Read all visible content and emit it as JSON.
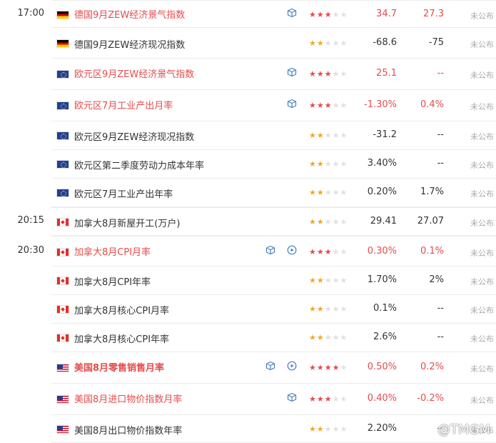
{
  "rows": [
    {
      "time": "17:00",
      "flag": "de",
      "name": "德国9月ZEW经济景气指数",
      "style": "red",
      "icons": [
        "box"
      ],
      "stars": 3,
      "star_color": "red",
      "actual": "34.7",
      "actual_red": true,
      "forecast": "27.3",
      "forecast_red": true,
      "status": "未公布"
    },
    {
      "time": "",
      "flag": "de",
      "name": "德国9月ZEW经济现况指数",
      "style": "normal",
      "icons": [],
      "stars": 2,
      "star_color": "yellow",
      "actual": "-68.6",
      "actual_red": false,
      "forecast": "-75",
      "forecast_red": false,
      "status": "未公布"
    },
    {
      "time": "",
      "flag": "eu",
      "name": "欧元区9月ZEW经济景气指数",
      "style": "red",
      "icons": [
        "box"
      ],
      "stars": 3,
      "star_color": "red",
      "actual": "25.1",
      "actual_red": true,
      "forecast": "--",
      "forecast_red": true,
      "status": "未公布"
    },
    {
      "time": "",
      "flag": "eu",
      "name": "欧元区7月工业产出月率",
      "style": "red",
      "icons": [
        "box"
      ],
      "stars": 3,
      "star_color": "red",
      "actual": "-1.30%",
      "actual_red": true,
      "forecast": "0.4%",
      "forecast_red": true,
      "status": "未公布"
    },
    {
      "time": "",
      "flag": "eu",
      "name": "欧元区9月ZEW经济现况指数",
      "style": "normal",
      "icons": [],
      "stars": 2,
      "star_color": "yellow",
      "actual": "-31.2",
      "actual_red": false,
      "forecast": "--",
      "forecast_red": false,
      "status": "未公布"
    },
    {
      "time": "",
      "flag": "eu",
      "name": "欧元区第二季度劳动力成本年率",
      "style": "normal",
      "icons": [],
      "stars": 2,
      "star_color": "yellow",
      "actual": "3.40%",
      "actual_red": false,
      "forecast": "--",
      "forecast_red": false,
      "status": "未公布"
    },
    {
      "time": "",
      "flag": "eu",
      "name": "欧元区7月工业产出年率",
      "style": "normal",
      "icons": [],
      "stars": 2,
      "star_color": "yellow",
      "actual": "0.20%",
      "actual_red": false,
      "forecast": "1.7%",
      "forecast_red": false,
      "status": "未公布"
    },
    {
      "time": "20:15",
      "flag": "ca",
      "name": "加拿大8月新屋开工(万户)",
      "style": "normal",
      "icons": [],
      "stars": 2,
      "star_color": "yellow",
      "actual": "29.41",
      "actual_red": false,
      "forecast": "27.07",
      "forecast_red": false,
      "status": "未公布"
    },
    {
      "time": "20:30",
      "flag": "ca",
      "name": "加拿大8月CPI月率",
      "style": "red",
      "icons": [
        "box",
        "play"
      ],
      "stars": 3,
      "star_color": "red",
      "actual": "0.30%",
      "actual_red": true,
      "forecast": "0.1%",
      "forecast_red": true,
      "status": "未公布"
    },
    {
      "time": "",
      "flag": "ca",
      "name": "加拿大8月CPI年率",
      "style": "normal",
      "icons": [],
      "stars": 2,
      "star_color": "yellow",
      "actual": "1.70%",
      "actual_red": false,
      "forecast": "2%",
      "forecast_red": false,
      "status": "未公布"
    },
    {
      "time": "",
      "flag": "ca",
      "name": "加拿大8月核心CPI月率",
      "style": "normal",
      "icons": [],
      "stars": 2,
      "star_color": "yellow",
      "actual": "0.1%",
      "actual_red": false,
      "forecast": "--",
      "forecast_red": false,
      "status": "未公布"
    },
    {
      "time": "",
      "flag": "ca",
      "name": "加拿大8月核心CPI年率",
      "style": "normal",
      "icons": [],
      "stars": 2,
      "star_color": "yellow",
      "actual": "2.6%",
      "actual_red": false,
      "forecast": "--",
      "forecast_red": false,
      "status": "未公布"
    },
    {
      "time": "",
      "flag": "us",
      "name": "美国8月零售销售月率",
      "style": "red-bold",
      "icons": [
        "box",
        "play"
      ],
      "stars": 4,
      "star_color": "red",
      "actual": "0.50%",
      "actual_red": true,
      "forecast": "0.2%",
      "forecast_red": true,
      "status": "未公布"
    },
    {
      "time": "",
      "flag": "us",
      "name": "美国8月进口物价指数月率",
      "style": "red",
      "icons": [
        "box"
      ],
      "stars": 3,
      "star_color": "red",
      "actual": "0.40%",
      "actual_red": true,
      "forecast": "-0.2%",
      "forecast_red": true,
      "status": "未公布"
    },
    {
      "time": "",
      "flag": "us",
      "name": "美国8月出口物价指数年率",
      "style": "normal",
      "icons": [],
      "stars": 2,
      "star_color": "yellow",
      "actual": "2.20%",
      "actual_red": false,
      "forecast": "--",
      "forecast_red": false,
      "status": "未公布"
    }
  ],
  "brand": "@TMGM",
  "colors": {
    "red": "#e64b4b",
    "star_yellow": "#f5a623",
    "star_empty": "#e0e0e0",
    "divider": "#ececec",
    "muted": "#aaaaaa"
  }
}
